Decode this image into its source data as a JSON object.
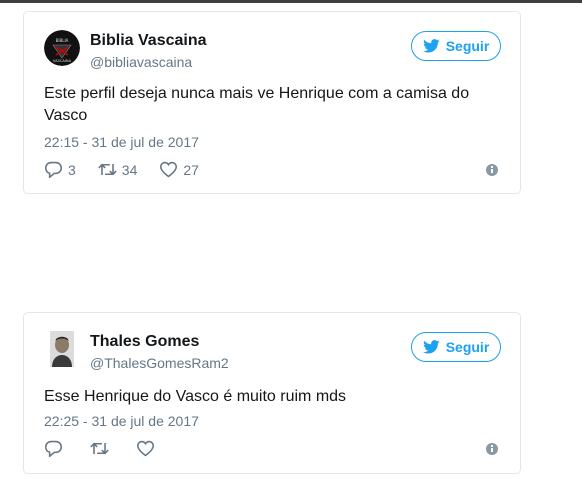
{
  "tweets": [
    {
      "name": "Biblia Vascaina",
      "handle": "@bibliavascaina",
      "follow_label": "Seguir",
      "text": "Este perfil deseja nunca mais ve Henrique com a camisa do Vasco",
      "timestamp": "22:15 - 31 de jul de 2017",
      "replies": "3",
      "retweets": "34",
      "likes": "27",
      "avatar_lines": [
        "BIBLIA",
        "VASCAINA"
      ]
    },
    {
      "name": "Thales Gomes",
      "handle": "@ThalesGomesRam2",
      "follow_label": "Seguir",
      "text": "Esse Henrique do Vasco é muito ruim mds",
      "timestamp": "22:25 - 31 de jul de 2017"
    }
  ],
  "colors": {
    "accent": "#1da1f2",
    "muted": "#657786",
    "border": "#e1e8ed"
  },
  "icons": [
    "twitter-bird-icon",
    "reply-icon",
    "retweet-icon",
    "like-icon",
    "info-icon"
  ]
}
